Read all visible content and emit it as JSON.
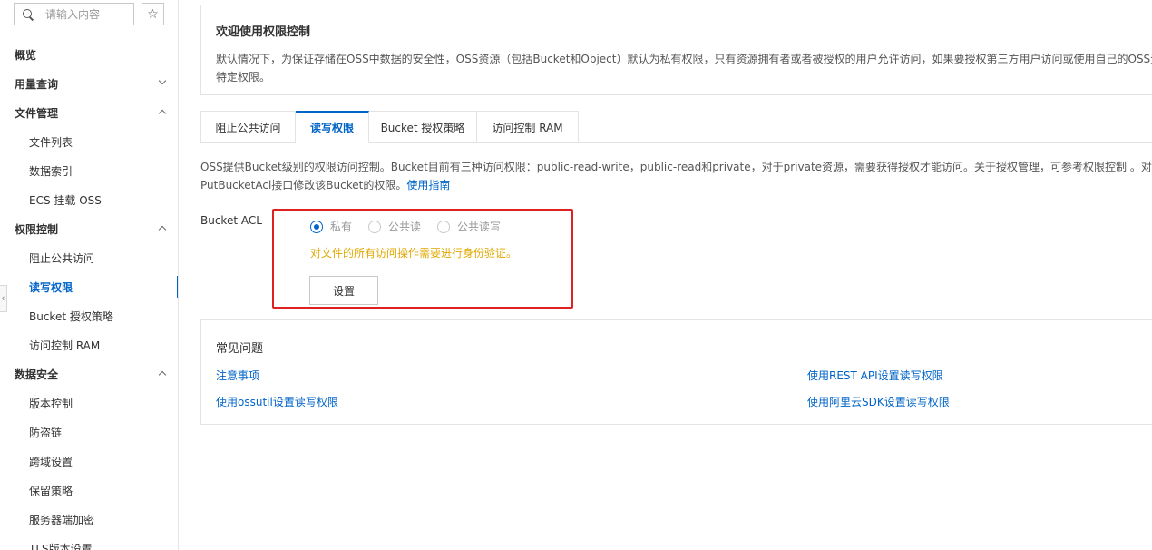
{
  "sidebar": {
    "search_placeholder": "请输入内容",
    "items": [
      {
        "label": "概览",
        "type": "group",
        "chevron": ""
      },
      {
        "label": "用量查询",
        "type": "group",
        "chevron": "down"
      },
      {
        "label": "文件管理",
        "type": "group",
        "chevron": "up"
      },
      {
        "label": "文件列表",
        "type": "sub"
      },
      {
        "label": "数据索引",
        "type": "sub"
      },
      {
        "label": "ECS 挂载 OSS",
        "type": "sub"
      },
      {
        "label": "权限控制",
        "type": "group",
        "chevron": "up"
      },
      {
        "label": "阻止公共访问",
        "type": "sub"
      },
      {
        "label": "读写权限",
        "type": "sub",
        "active": true
      },
      {
        "label": "Bucket 授权策略",
        "type": "sub"
      },
      {
        "label": "访问控制 RAM",
        "type": "sub"
      },
      {
        "label": "数据安全",
        "type": "group",
        "chevron": "up"
      },
      {
        "label": "版本控制",
        "type": "sub"
      },
      {
        "label": "防盗链",
        "type": "sub"
      },
      {
        "label": "跨域设置",
        "type": "sub"
      },
      {
        "label": "保留策略",
        "type": "sub"
      },
      {
        "label": "服务器端加密",
        "type": "sub"
      },
      {
        "label": "TLS版本设置",
        "type": "sub"
      }
    ]
  },
  "welcome": {
    "title": "欢迎使用权限控制",
    "desc_line1": "默认情况下，为保证存储在OSS中数据的安全性，OSS资源（包括Bucket和Object）默认为私有权限，只有资源拥有者或者被授权的用户允许访问，如果要授权第三方用户访问或使用自己的OSS资源",
    "desc_line2": "特定权限。"
  },
  "tabs": [
    {
      "label": "阻止公共访问",
      "active": false
    },
    {
      "label": "读写权限",
      "active": true
    },
    {
      "label": "Bucket 授权策略",
      "active": false
    },
    {
      "label": "访问控制 RAM",
      "active": false
    }
  ],
  "info": {
    "line1": "OSS提供Bucket级别的权限访问控制。Bucket目前有三种访问权限：public-read-write，public-read和private，对于private资源，需要获得授权才能访问。关于授权管理，可参考权限控制 。对于一个已",
    "line2": "PutBucketAcl接口修改该Bucket的权限。",
    "link": "使用指南"
  },
  "acl": {
    "label": "Bucket ACL",
    "options": [
      {
        "label": "私有",
        "checked": true
      },
      {
        "label": "公共读",
        "checked": false
      },
      {
        "label": "公共读写",
        "checked": false
      }
    ],
    "hint": "对文件的所有访问操作需要进行身份验证。",
    "button": "设置"
  },
  "faq": {
    "title": "常见问题",
    "links": [
      "注意事项",
      "使用REST API设置读写权限",
      "使用ossutil设置读写权限",
      "使用阿里云SDK设置读写权限"
    ]
  },
  "colors": {
    "accent": "#0064c8",
    "warning": "#e0a800",
    "highlight": "#e02020"
  }
}
